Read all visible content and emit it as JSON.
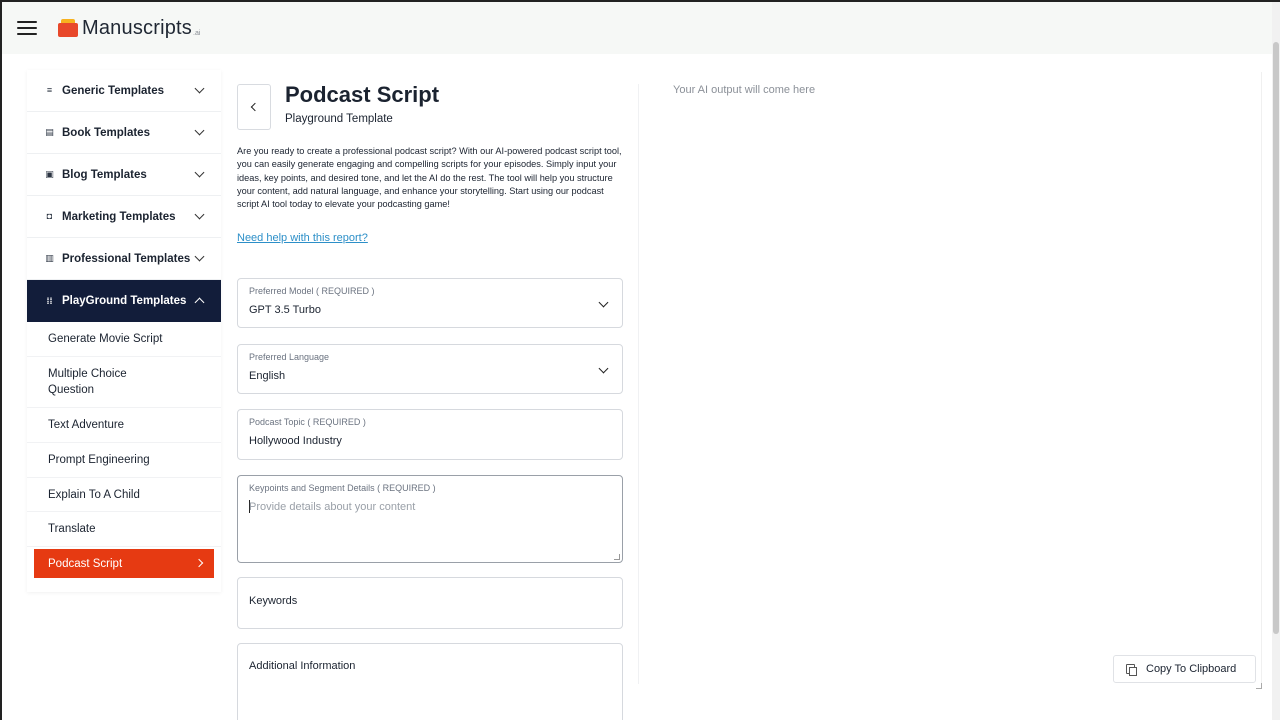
{
  "header": {
    "app_name": "Manuscripts",
    "app_suffix": ".ai",
    "menu_icon": "hamburger-icon",
    "logo_icon": "logo-icon"
  },
  "sidebar": {
    "groups": [
      {
        "label": "Generic Templates",
        "icon": "≡"
      },
      {
        "label": "Book Templates",
        "icon": "▤"
      },
      {
        "label": "Blog Templates",
        "icon": "▣"
      },
      {
        "label": "Marketing Templates",
        "icon": "◘"
      },
      {
        "label": "Professional Templates",
        "icon": "▥"
      },
      {
        "label": "PlayGround Templates",
        "icon": "⁞⁞"
      }
    ],
    "items": [
      {
        "label": "Generate Movie Script"
      },
      {
        "label": "Multiple Choice Question"
      },
      {
        "label": "Text Adventure"
      },
      {
        "label": "Prompt Engineering"
      },
      {
        "label": "Explain To A Child"
      },
      {
        "label": "Translate"
      },
      {
        "label": "Podcast Script"
      }
    ]
  },
  "main": {
    "title": "Podcast Script",
    "subtitle": "Playground Template",
    "description": "Are you ready to create a professional podcast script? With our AI-powered podcast script tool, you can easily generate engaging and compelling scripts for your episodes. Simply input your ideas, key points, and desired tone, and let the AI do the rest. The tool will help you structure your content, add natural language, and enhance your storytelling. Start using our podcast script AI tool today to elevate your podcasting game!",
    "help_link": "Need help with this report?",
    "fields": {
      "model": {
        "label": "Preferred Model ( REQUIRED )",
        "value": "GPT 3.5 Turbo"
      },
      "language": {
        "label": "Preferred Language",
        "value": "English"
      },
      "topic": {
        "label": "Podcast Topic ( REQUIRED )",
        "value": "Hollywood Industry"
      },
      "keypoints": {
        "label": "Keypoints and Segment Details ( REQUIRED )",
        "placeholder": "Provide details about your content"
      },
      "keywords": {
        "label": "Keywords"
      },
      "additional": {
        "label": "Additional Information"
      }
    }
  },
  "output": {
    "placeholder": "Your AI output will come here",
    "copy_label": "Copy To Clipboard"
  }
}
